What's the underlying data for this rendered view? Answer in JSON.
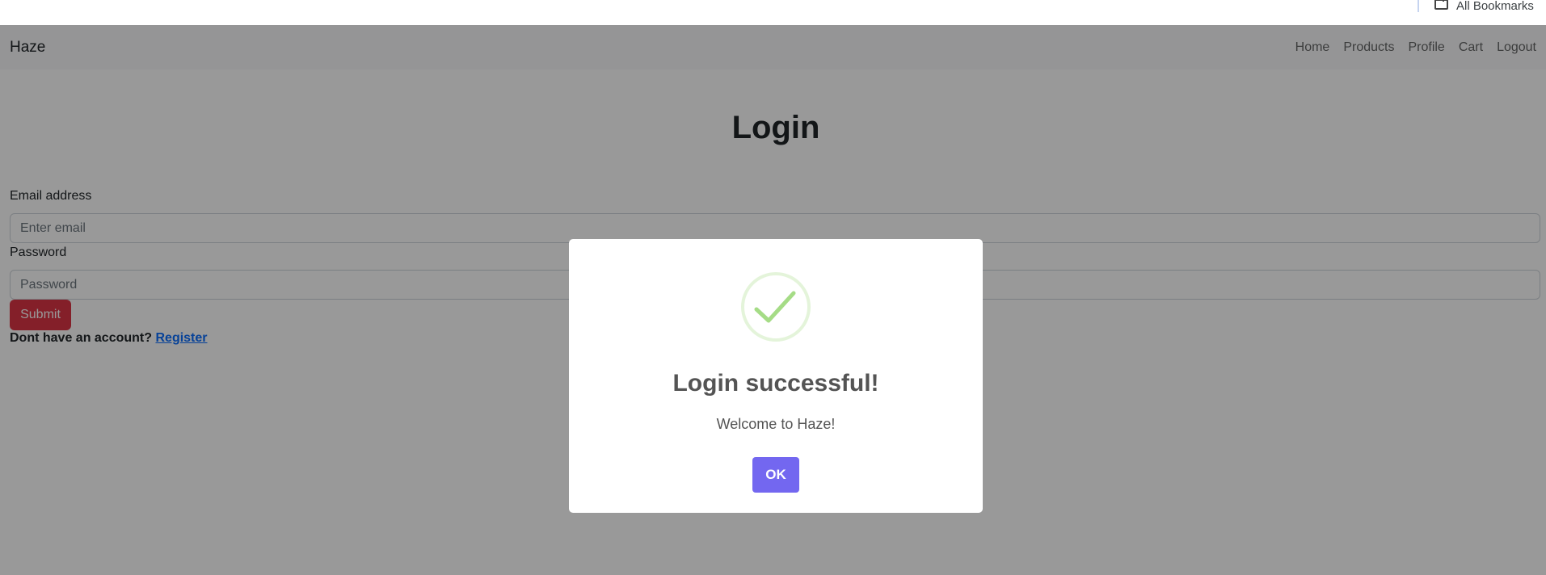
{
  "browser": {
    "bookmarks_label": "All Bookmarks"
  },
  "navbar": {
    "brand": "Haze",
    "links": [
      "Home",
      "Products",
      "Profile",
      "Cart",
      "Logout"
    ]
  },
  "form": {
    "title": "Login",
    "email_label": "Email address",
    "email_placeholder": "Enter email",
    "password_label": "Password",
    "password_placeholder": "Password",
    "submit_label": "Submit",
    "register_prompt": "Dont have an account?",
    "register_link": "Register"
  },
  "modal": {
    "icon": "success-check-icon",
    "title": "Login successful!",
    "text": "Welcome to Haze!",
    "ok_label": "OK"
  },
  "colors": {
    "primary_danger": "#dc3545",
    "modal_confirm": "#7367f0",
    "success_green": "#a5dc86"
  }
}
